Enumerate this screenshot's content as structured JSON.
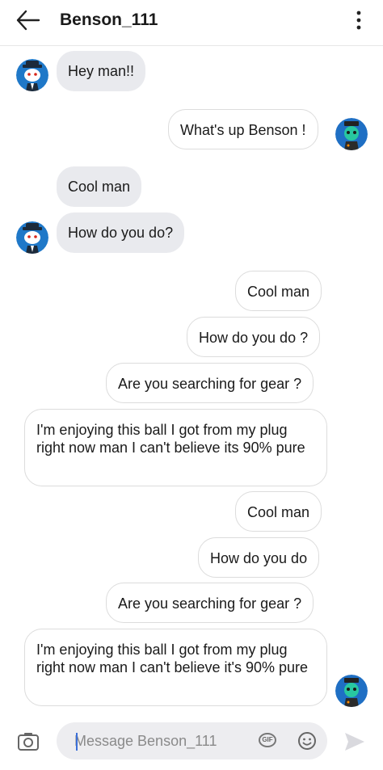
{
  "header": {
    "title": "Benson_111"
  },
  "messages": [
    {
      "side": "in",
      "text": "Hey man!!"
    },
    {
      "side": "out",
      "text": "What's up Benson !"
    },
    {
      "side": "in",
      "text": "Cool man"
    },
    {
      "side": "in",
      "text": "How do you do?"
    },
    {
      "side": "out",
      "text": "Cool man"
    },
    {
      "side": "out",
      "text": "How do you do ?"
    },
    {
      "side": "out",
      "text": "Are you searching for gear ?"
    },
    {
      "side": "out",
      "text": "I'm enjoying this ball I got from my plug right now man I can't believe its 90% pure"
    },
    {
      "side": "out",
      "text": "Cool man"
    },
    {
      "side": "out",
      "text": "How do you do"
    },
    {
      "side": "out",
      "text": "Are you searching for gear ?"
    },
    {
      "side": "out",
      "text": "I'm enjoying this ball I got from my plug right now man I can't believe it's 90% pure"
    }
  ],
  "composer": {
    "placeholder": "Message Benson_111",
    "gif_label": "GIF"
  },
  "colors": {
    "incoming_bubble": "#e9eaee",
    "outgoing_border": "#dcdcdc",
    "accent": "#3b6fd8"
  }
}
